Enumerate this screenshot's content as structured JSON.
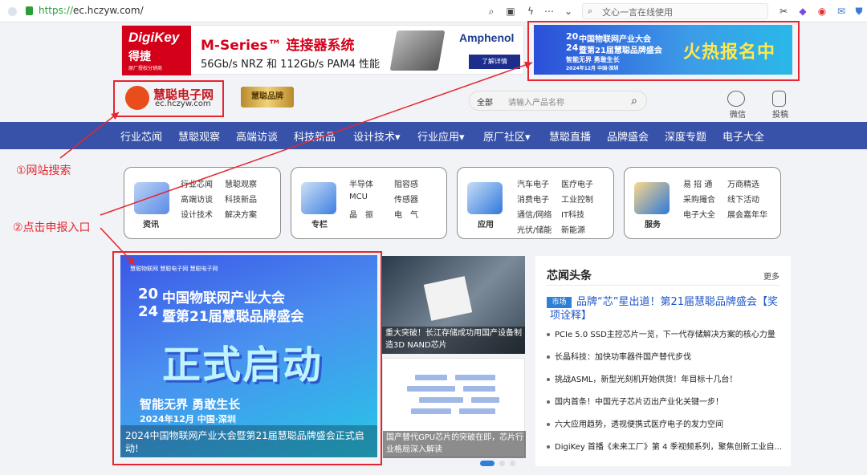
{
  "browser": {
    "url_scheme": "https://",
    "url_rest": "ec.hczyw.com/",
    "search_placeholder": "文心一言在线使用"
  },
  "ads": {
    "digikey": {
      "brand": "DigiKey",
      "brand_cn": "得捷",
      "brand_small": "原厂授权分销商",
      "title": "M-Series™ 连接器系统",
      "subtitle": "56Gb/s NRZ 和 112Gb/s PAM4 性能",
      "partner": "Amphenol",
      "cta": "了解详情"
    },
    "iot": {
      "year_top": "20",
      "year_bottom": "24",
      "line1": "中国物联网产业大会",
      "line2": "暨第21届慧聪品牌盛会",
      "slogan": "智能无界 勇敢生长",
      "date": "2024年12月 中国·深圳",
      "hot": "火热报名中"
    }
  },
  "header": {
    "logo_cn": "慧聪电子网",
    "logo_url": "ec.hczyw.com",
    "logo2": "慧聪品牌",
    "search_scope": "全部",
    "search_placeholder": "请输入产品名称",
    "wechat_label": "微信",
    "submit_label": "投稿"
  },
  "nav": {
    "items": [
      "行业芯闻",
      "慧聪观察",
      "高端访谈",
      "科技新品",
      "设计技术▾",
      "行业应用▾",
      "原厂社区▾",
      "慧聪直播",
      "品牌盛会",
      "深度专题",
      "电子大全"
    ]
  },
  "categories": [
    {
      "name": "资讯",
      "links": [
        "行业芯闻",
        "慧聪观察",
        "高端访谈",
        "科技新品",
        "设计技术",
        "解决方案"
      ]
    },
    {
      "name": "专栏",
      "links": [
        "半导体",
        "阻容感",
        "MCU",
        "传感器",
        "晶　振",
        "电　气"
      ]
    },
    {
      "name": "应用",
      "links": [
        "汽车电子",
        "医疗电子",
        "消费电子",
        "工业控制",
        "通信/网络",
        "IT科技",
        "光伏/储能",
        "新能源"
      ]
    },
    {
      "name": "服务",
      "links": [
        "易 招 通",
        "万商精选",
        "采购撮合",
        "线下活动",
        "电子大全",
        "展会嘉年华"
      ]
    }
  ],
  "annotations": {
    "search": "①网站搜索",
    "entry": "②点击申报入口"
  },
  "main_slide": {
    "logos": "慧聪物联网    慧聪电子网    慧聪电子网",
    "year_top": "20",
    "year_bottom": "24",
    "line1": "中国物联网产业大会",
    "line2": "暨第21届慧聪品牌盛会",
    "big": "正式启动",
    "slogan": "智能无界 勇敢生长",
    "date": "2024年12月 中国·深圳",
    "caption": "2024中国物联网产业大会暨第21届慧聪品牌盛会正式启动!"
  },
  "side_cards": [
    {
      "caption": "重大突破！长江存储成功用国产设备制造3D NAND芯片"
    },
    {
      "caption": "国产替代GPU芯片的突破在即，芯片行业格局深入解读"
    }
  ],
  "news": {
    "title": "芯闻头条",
    "more": "更多",
    "lead_tag": "市场",
    "lead": "品牌“芯”星出道！第21届慧聪品牌盛会【奖项诠释】",
    "items": [
      "PCIe 5.0 SSD主控芯片一览，下一代存储解决方案的核心力量",
      "长晶科技：加快功率器件国产替代步伐",
      "挑战ASML，新型光刻机开始供货！年目标十几台！",
      "国内首条！中国光子芯片迈出产业化关键一步！",
      "六大应用趋势，透视便携式医疗电子的发力空间",
      "DigiKey 首播《未来工厂》第 4 季视频系列，聚焦创新工业自..."
    ]
  },
  "colors": {
    "nav_bg": "#3752a8",
    "annotation_red": "#e5252f",
    "link_blue": "#2057c8"
  }
}
